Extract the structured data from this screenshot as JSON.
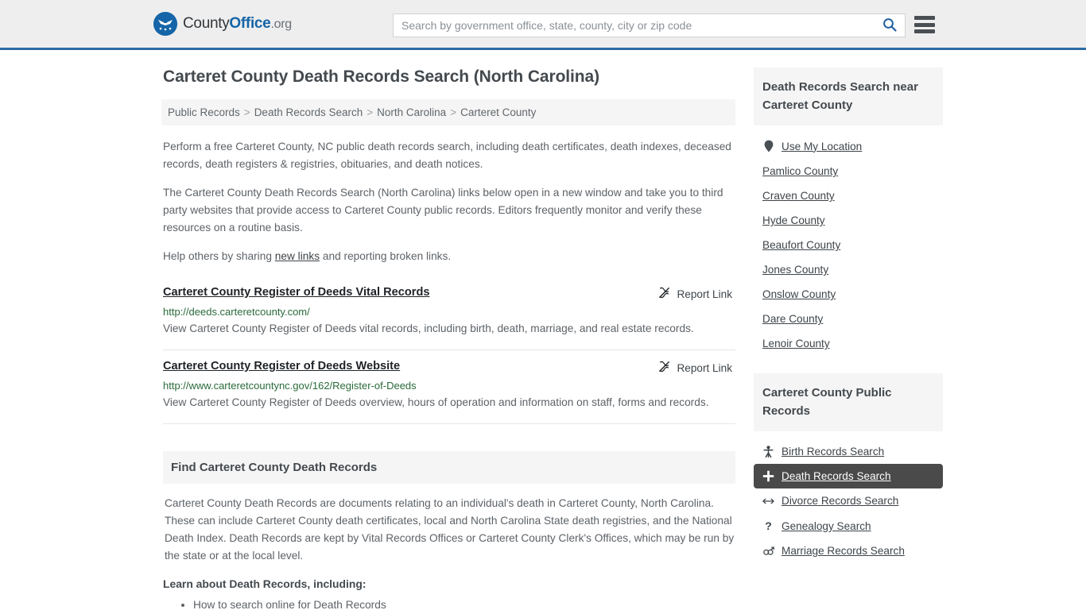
{
  "header": {
    "logo": {
      "part1": "County",
      "part2": "Office",
      "part3": ".org",
      "icon": "eagle-seal-icon"
    },
    "search": {
      "placeholder": "Search by government office, state, county, city or zip code",
      "value": ""
    },
    "search_icon": "search-icon",
    "menu_icon": "hamburger-menu-icon"
  },
  "main": {
    "title": "Carteret County Death Records Search (North Carolina)",
    "breadcrumb": [
      {
        "label": "Public Records"
      },
      {
        "label": "Death Records Search"
      },
      {
        "label": "North Carolina"
      },
      {
        "label": "Carteret County"
      }
    ],
    "breadcrumb_separator": ">",
    "intro_1": "Perform a free Carteret County, NC public death records search, including death certificates, death indexes, deceased records, death registers & registries, obituaries, and death notices.",
    "intro_2": "The Carteret County Death Records Search (North Carolina) links below open in a new window and take you to third party websites that provide access to Carteret County public records. Editors frequently monitor and verify these resources on a routine basis.",
    "help_prefix": "Help others by sharing ",
    "help_link": "new links",
    "help_suffix": " and reporting broken links.",
    "report_label": "Report Link",
    "report_icon": "broken-link-icon",
    "links": [
      {
        "title": "Carteret County Register of Deeds Vital Records",
        "url": "http://deeds.carteretcounty.com/",
        "description": "View Carteret County Register of Deeds vital records, including birth, death, marriage, and real estate records."
      },
      {
        "title": "Carteret County Register of Deeds Website",
        "url": "http://www.carteretcountync.gov/162/Register-of-Deeds",
        "description": "View Carteret County Register of Deeds overview, hours of operation and information on staff, forms and records."
      }
    ],
    "section_title": "Find Carteret County Death Records",
    "section_body": "Carteret County Death Records are documents relating to an individual's death in Carteret County, North Carolina. These can include Carteret County death certificates, local and North Carolina State death registries, and the National Death Index. Death Records are kept by Vital Records Offices or Carteret County Clerk's Offices, which may be run by the state or at the local level.",
    "learn_heading": "Learn about Death Records, including:",
    "learn_items": [
      "How to search online for Death Records"
    ]
  },
  "sidebar": {
    "nearby": {
      "heading": "Death Records Search near Carteret County",
      "use_location": {
        "label": "Use My Location",
        "icon": "map-pin-icon"
      },
      "counties": [
        "Pamlico County",
        "Craven County",
        "Hyde County",
        "Beaufort County",
        "Jones County",
        "Onslow County",
        "Dare County",
        "Lenoir County"
      ]
    },
    "public_records": {
      "heading": "Carteret County Public Records",
      "items": [
        {
          "label": "Birth Records Search",
          "icon": "baby-icon",
          "glyph": "Ɣ",
          "active": false
        },
        {
          "label": "Death Records Search",
          "icon": "cross-plus-icon",
          "glyph": "✚",
          "active": true
        },
        {
          "label": "Divorce Records Search",
          "icon": "left-right-arrow-icon",
          "glyph": "↔",
          "active": false
        },
        {
          "label": "Genealogy Search",
          "icon": "question-mark-icon",
          "glyph": "?",
          "active": false
        },
        {
          "label": "Marriage Records Search",
          "icon": "male-female-symbol-icon",
          "glyph": "⚥",
          "active": false
        }
      ]
    }
  },
  "colors": {
    "header_bg": "#eeeeee",
    "header_border": "#2c6ca5",
    "brand_blue": "#1565a8",
    "panel_bg": "#f5f5f5",
    "url_green": "#2a6b3a",
    "active_bg": "#4a4a4a",
    "body_text": "#5d6267"
  }
}
